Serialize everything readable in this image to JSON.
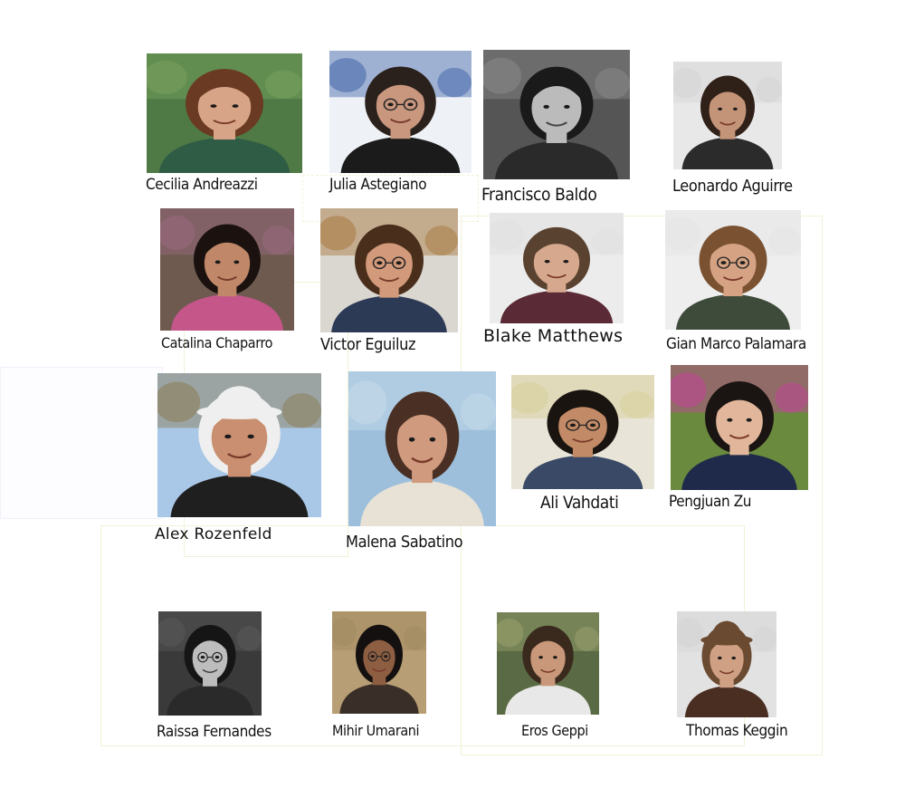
{
  "people": [
    {
      "name": "Cecilia Andreazzi",
      "photo": {
        "bg": "#4f7a45",
        "skin": "#d8a487",
        "hair": "#6a3a22",
        "shirt": "#2f5c45",
        "alt_bg": "#7aa35f",
        "glasses": false,
        "hat": false,
        "grayscale": false
      }
    },
    {
      "name": "Julia Astegiano",
      "photo": {
        "bg": "#eef2f6",
        "skin": "#c9967e",
        "hair": "#2a201c",
        "shirt": "#1b1b1b",
        "alt_bg": "#3e62a8",
        "glasses": true,
        "hat": false,
        "grayscale": false
      }
    },
    {
      "name": "Francisco Baldo",
      "photo": {
        "bg": "#555555",
        "skin": "#bbbbbb",
        "hair": "#1a1a1a",
        "shirt": "#2a2a2a",
        "alt_bg": "#8a8a8a",
        "glasses": false,
        "hat": false,
        "grayscale": true
      }
    },
    {
      "name": "Leonardo Aguirre",
      "photo": {
        "bg": "#e8e8e8",
        "skin": "#c49478",
        "hair": "#2f2018",
        "shirt": "#2b2b2b",
        "alt_bg": "#d4d4d4",
        "glasses": false,
        "hat": false,
        "grayscale": false
      }
    },
    {
      "name": "Catalina Chaparro",
      "photo": {
        "bg": "#6e5a4e",
        "skin": "#c08868",
        "hair": "#1b1210",
        "shirt": "#c4568a",
        "alt_bg": "#9a6a82",
        "glasses": false,
        "hat": false,
        "grayscale": false
      }
    },
    {
      "name": "Victor Eguiluz",
      "photo": {
        "bg": "#d9d7cf",
        "skin": "#d29a7a",
        "hair": "#4a2e1c",
        "shirt": "#2c3a55",
        "alt_bg": "#a8783e",
        "glasses": true,
        "hat": false,
        "grayscale": false
      }
    },
    {
      "name": "Blake Matthews",
      "photo": {
        "bg": "#ececec",
        "skin": "#d6a88e",
        "hair": "#5a4230",
        "shirt": "#5a2a36",
        "alt_bg": "#e0e0e0",
        "glasses": false,
        "hat": false,
        "grayscale": false
      }
    },
    {
      "name": "Gian Marco Palamara",
      "photo": {
        "bg": "#eeeeee",
        "skin": "#d5a384",
        "hair": "#7a5232",
        "shirt": "#3e4a3a",
        "alt_bg": "#e4e4e4",
        "glasses": true,
        "hat": false,
        "grayscale": false
      }
    },
    {
      "name": "Alex Rozenfeld",
      "photo": {
        "bg": "#a9c7e6",
        "skin": "#c98f70",
        "hair": "#efefef",
        "shirt": "#1f1f1f",
        "alt_bg": "#8a7a52",
        "glasses": false,
        "hat": true,
        "grayscale": false
      }
    },
    {
      "name": "Malena Sabatino",
      "photo": {
        "bg": "#9dbfdb",
        "skin": "#cf9a7e",
        "hair": "#4a3024",
        "shirt": "#e8e2d6",
        "alt_bg": "#c6dbea",
        "glasses": false,
        "hat": false,
        "grayscale": false
      }
    },
    {
      "name": "Ali Vahdati",
      "photo": {
        "bg": "#e8e4d8",
        "skin": "#c28a66",
        "hair": "#1a1410",
        "shirt": "#3a4a66",
        "alt_bg": "#d8cf9a",
        "glasses": true,
        "hat": false,
        "grayscale": false
      }
    },
    {
      "name": "Pengjuan Zu",
      "photo": {
        "bg": "#6a8a3e",
        "skin": "#e2b69a",
        "hair": "#1a1512",
        "shirt": "#1f2a4a",
        "alt_bg": "#c2449a",
        "glasses": false,
        "hat": false,
        "grayscale": false
      }
    },
    {
      "name": "Raissa Fernandes",
      "photo": {
        "bg": "#3a3a3a",
        "skin": "#bdbdbd",
        "hair": "#151515",
        "shirt": "#2a2a2a",
        "alt_bg": "#5a5a5a",
        "glasses": true,
        "hat": false,
        "grayscale": true
      }
    },
    {
      "name": "Mihir Umarani",
      "photo": {
        "bg": "#b89e74",
        "skin": "#8e5e42",
        "hair": "#151010",
        "shirt": "#3a2e28",
        "alt_bg": "#a08860",
        "glasses": true,
        "hat": false,
        "grayscale": false
      }
    },
    {
      "name": "Eros Geppi",
      "photo": {
        "bg": "#5a6a44",
        "skin": "#c9987a",
        "hair": "#3a2a1e",
        "shirt": "#e8e8e8",
        "alt_bg": "#9aa26e",
        "glasses": false,
        "hat": false,
        "grayscale": false
      }
    },
    {
      "name": "Thomas Keggin",
      "photo": {
        "bg": "#e2e2e2",
        "skin": "#d0a084",
        "hair": "#6a4a30",
        "shirt": "#4a2e22",
        "alt_bg": "#d4d4d4",
        "glasses": false,
        "hat": true,
        "grayscale": false
      }
    }
  ]
}
